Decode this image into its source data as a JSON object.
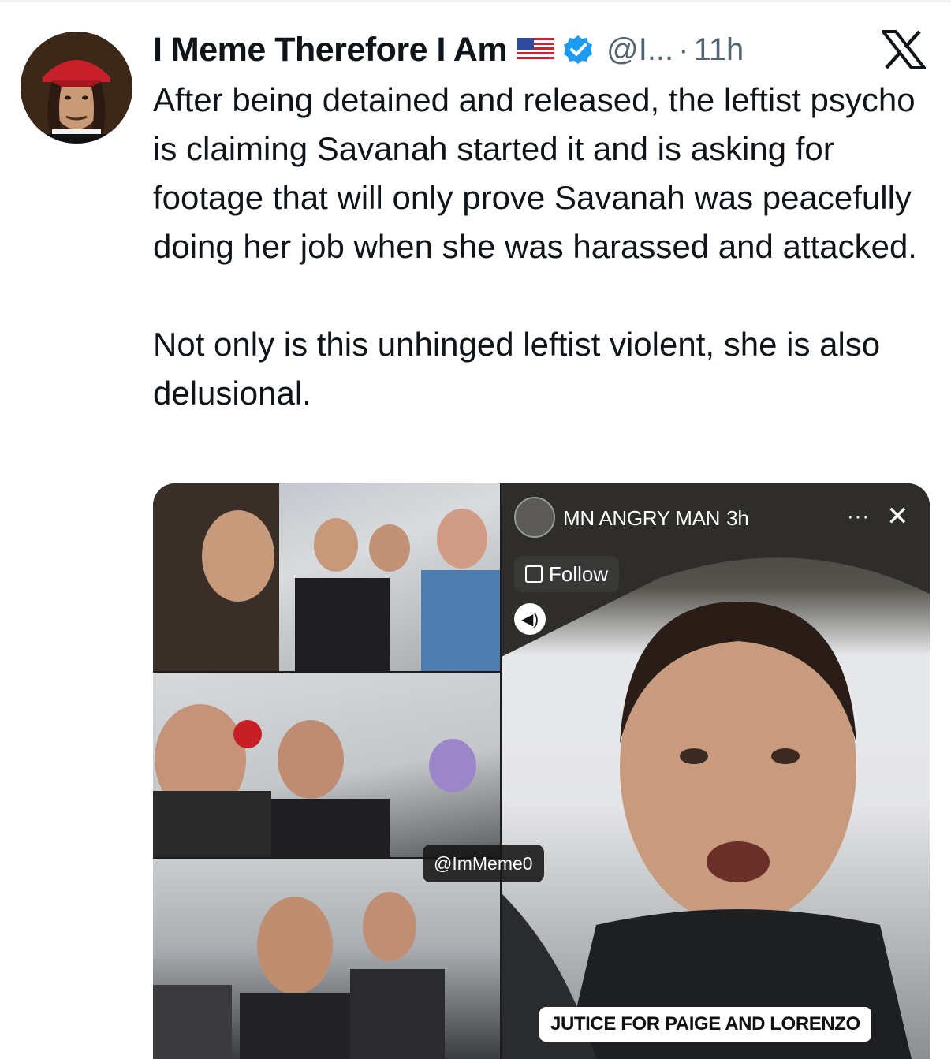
{
  "tweet": {
    "display_name": "I Meme Therefore I Am",
    "flag_emoji_name": "us-flag-icon",
    "verified": true,
    "handle": "@I...",
    "separator": "·",
    "time": "11h",
    "paragraphs": [
      "After being detained and released, the leftist psycho is claiming Savanah started it and is asking for footage that will only prove Savanah was peacefully doing her job when she was harassed and attacked.",
      "Not only is this unhinged leftist violent, she is also delusional."
    ]
  },
  "media": {
    "story_user": "MN ANGRY MAN",
    "story_time": "3h",
    "more_dots": "···",
    "close_glyph": "✕",
    "follow_label": "Follow",
    "sound_glyph": "◀)",
    "watermark": "@ImMeme0",
    "caption": "JUTICE FOR PAIGE AND LORENZO"
  },
  "colors": {
    "text": "#0f1419",
    "secondary": "#536471",
    "verified_blue": "#1d9bf0"
  }
}
